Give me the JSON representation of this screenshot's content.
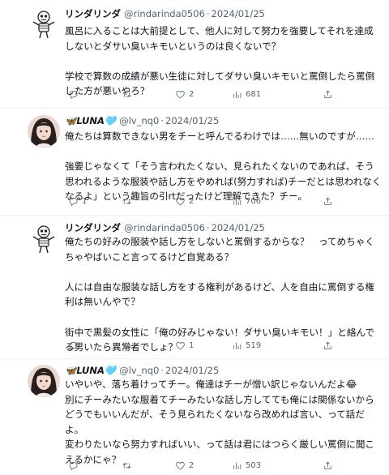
{
  "tweets": [
    {
      "name": "リンダリンダ",
      "handle": "@rindarinda0506",
      "sep": "·",
      "date": "2024/01/25",
      "avatar": "skeleton-avatar",
      "text": "風呂に入ることは大前提として、他人に対して努力を強要してそれを達成しないとダサい臭いキモいというのは良くないで？\n\n学校で算数の成績が悪い生徒に対してダサい臭いキモいと罵倒したら罵倒した方が悪いやろ？",
      "stats": {
        "replies": "",
        "retweets": "",
        "likes": "2",
        "views": "681"
      }
    },
    {
      "name": "🦋LUNA🩵",
      "handle": "@lv_nq0",
      "sep": "·",
      "date": "2024/01/25",
      "avatar": "girl-avatar",
      "text": "俺たちは算数できない男をチーと呼んでるわけでは……無いのですが……\n\n強要じゃなくて「そう言われたくない、見られたくないのであれば、そう思われるような服装や話し方をやめれば(努力すれば)チーだとは思われなくなるよ」という趣旨の引rtだったけど理解できた？チー。",
      "stats": {
        "replies": "1",
        "retweets": "",
        "likes": "2",
        "views": "706"
      }
    },
    {
      "name": "リンダリンダ",
      "handle": "@rindarinda0506",
      "sep": "·",
      "date": "2024/01/25",
      "avatar": "skeleton-avatar",
      "text": "俺たちの好みの服装や話し方をしないと罵倒するからな？　ってめちゃくちゃやばいこと言ってるけど自覚ある？\n\n人には自由な服装な話し方をする権利があるけど、人を自由に罵倒する権利は無いんやで？\n\n街中で黒髪の女性に「俺の好みじゃない！ダサい臭いキモい！」と絡んでる男いたら異常者でしょ？",
      "stats": {
        "replies": "",
        "retweets": "",
        "likes": "1",
        "views": "519"
      }
    },
    {
      "name": "🦋LUNA🩵",
      "handle": "@lv_nq0",
      "sep": "·",
      "date": "2024/01/25",
      "avatar": "girl-avatar",
      "text": "いやいや、落ち着けってチー。俺達はチーが憎い訳じゃないんだよ😂\n別にチーみたいな服着てチーみたいな話し方してても俺には関係ないから どうでもいいんだが、そう見られたくないなら改めれば言い、って話だよ。\n変わりたいなら努力すればいい、って話は君にはつらく厳しい罵倒に聞こえるかにゃ？",
      "stats": {
        "replies": "",
        "retweets": "",
        "likes": "2",
        "views": "503"
      }
    }
  ],
  "icons": {
    "reply": "reply-icon",
    "retweet": "retweet-icon",
    "like": "heart-icon",
    "views": "views-icon",
    "share": "share-icon"
  },
  "colors": {
    "text": "#0f1419",
    "secondary": "#536471",
    "divider": "#eff3f4",
    "background": "#ffffff"
  }
}
